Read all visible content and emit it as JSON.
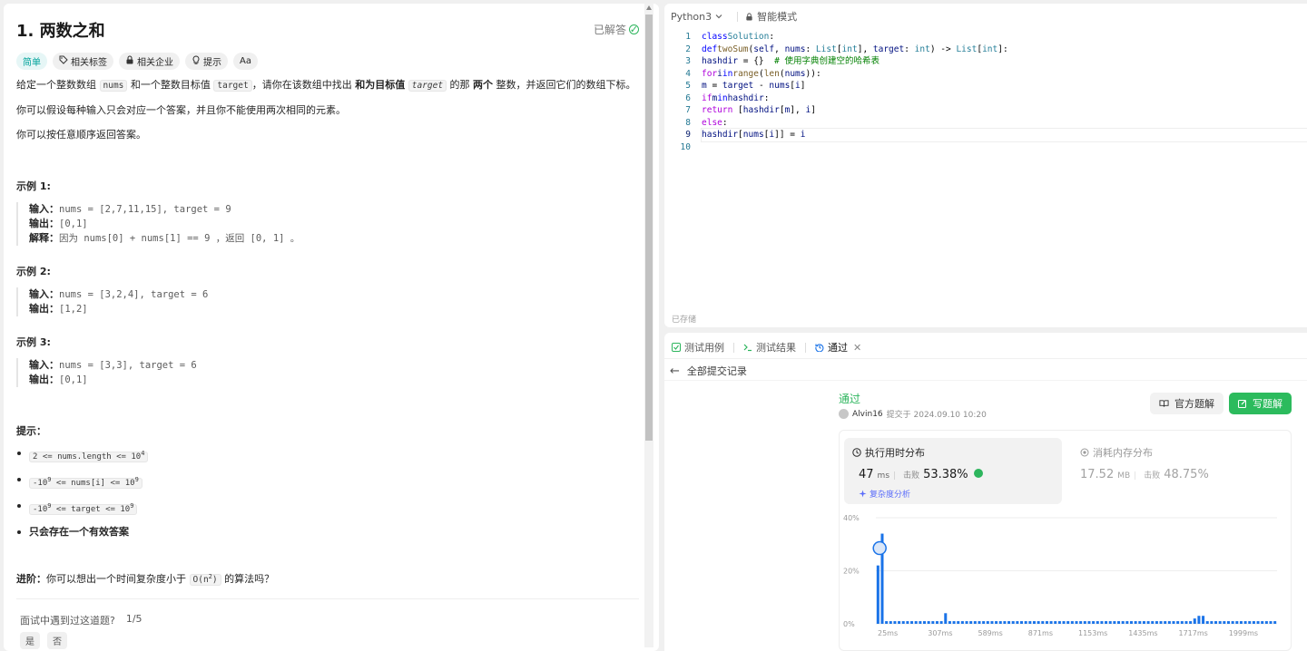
{
  "problem": {
    "title": "1. 两数之和",
    "solved_label": "已解答",
    "tags": [
      {
        "label": "简单",
        "icon": ""
      },
      {
        "label": "相关标签",
        "icon": "tag-icon"
      },
      {
        "label": "相关企业",
        "icon": "lock-icon"
      },
      {
        "label": "提示",
        "icon": "bulb-icon"
      },
      {
        "label": "Aa",
        "icon": "font-icon"
      }
    ],
    "desc_1": {
      "a": "给定一个整数数组 ",
      "code1": "nums",
      "b": " 和一个整数目标值 ",
      "code2": "target",
      "c": "，请你在该数组中找出 ",
      "bold1": "和为目标值",
      "code3": "target",
      "d": " 的那 ",
      "bold2": "两个",
      "e": " 整数，并返回它们的数组下标。"
    },
    "desc_2": "你可以假设每种输入只会对应一个答案，并且你不能使用两次相同的元素。",
    "desc_3": "你可以按任意顺序返回答案。",
    "examples": [
      {
        "title": "示例 1:",
        "input_label": "输入：",
        "input": "nums = [2,7,11,15], target = 9",
        "output_label": "输出：",
        "output": "[0,1]",
        "explain_label": "解释：",
        "explain": "因为 nums[0] + nums[1] == 9 ，返回 [0, 1] 。"
      },
      {
        "title": "示例 2:",
        "input_label": "输入：",
        "input": "nums = [3,2,4], target = 6",
        "output_label": "输出：",
        "output": "[1,2]"
      },
      {
        "title": "示例 3:",
        "input_label": "输入：",
        "input": "nums = [3,3], target = 6",
        "output_label": "输出：",
        "output": "[0,1]"
      }
    ],
    "hints_title": "提示：",
    "hints": [
      {
        "pre": "2 <= nums.length <= 10",
        "sup": "4",
        "post": ""
      },
      {
        "pre": "-10",
        "sup": "9",
        "mid": " <= nums[i] <= 10",
        "sup2": "9"
      },
      {
        "pre": "-10",
        "sup": "9",
        "mid": " <= target <= 10",
        "sup2": "9"
      }
    ],
    "hint_bold": "只会存在一个有效答案",
    "advanced_label": "进阶：",
    "advanced_a": "你可以想出一个时间复杂度小于 ",
    "advanced_code": "O(n",
    "advanced_sup": "2",
    "advanced_code_end": ")",
    "advanced_b": " 的算法吗？",
    "interview_q": "面试中遇到过这道题?",
    "interview_count": "1/5",
    "yes": "是",
    "no": "否"
  },
  "editor": {
    "language": "Python3",
    "mode": "智能模式",
    "saved": "已存储"
  },
  "results": {
    "tabs": [
      {
        "label": "测试用例",
        "icon": "check-square-icon"
      },
      {
        "label": "测试结果",
        "icon": "terminal-icon"
      },
      {
        "label": "通过",
        "icon": "history-icon"
      }
    ],
    "back_label": "全部提交记录",
    "status": "通过",
    "user": "Alvin16",
    "submitted_at": "提交于 2024.09.10 10:20",
    "official_solution": "官方题解",
    "write_solution": "写题解",
    "runtime": {
      "title": "执行用时分布",
      "value": "47",
      "unit": "ms",
      "beat_label": "击败",
      "beat_pct": "53.38%",
      "analysis": "复杂度分析"
    },
    "memory": {
      "title": "消耗内存分布",
      "value": "17.52",
      "unit": "MB",
      "beat_label": "击败",
      "beat_pct": "48.75%"
    }
  },
  "chart_data": {
    "type": "bar",
    "ylabel": "",
    "ylim": [
      0,
      40
    ],
    "y_ticks": [
      "40%",
      "20%",
      "0%"
    ],
    "x_ticks": [
      "25ms",
      "307ms",
      "589ms",
      "871ms",
      "1153ms",
      "1435ms",
      "1717ms",
      "1999ms"
    ],
    "values": [
      22,
      34,
      1,
      1,
      1,
      1,
      1,
      1,
      1,
      1,
      1,
      1,
      1,
      1,
      1,
      1,
      4,
      1,
      1,
      1,
      1,
      1,
      1,
      1,
      1,
      1,
      1,
      1,
      1,
      1,
      1,
      1,
      1,
      1,
      1,
      1,
      1,
      1,
      1,
      1,
      1,
      1,
      1,
      1,
      1,
      1,
      1,
      1,
      1,
      1,
      1,
      1,
      1,
      1,
      1,
      1,
      1,
      1,
      1,
      1,
      1,
      1,
      1,
      1,
      1,
      1,
      1,
      1,
      1,
      1,
      1,
      1,
      1,
      1,
      1,
      2,
      3,
      3,
      1,
      1,
      1,
      1,
      1,
      1,
      1,
      1,
      1,
      1,
      1,
      1,
      1,
      1,
      1,
      1,
      1
    ],
    "highlight_index": 1,
    "bar_color": "#1a73e8",
    "grid": true
  },
  "colors": {
    "accent_green": "#2db55d",
    "button_green": "#2cbb5d",
    "easy_teal": "#00a39b",
    "analysis_blue": "#5a6cfa"
  }
}
